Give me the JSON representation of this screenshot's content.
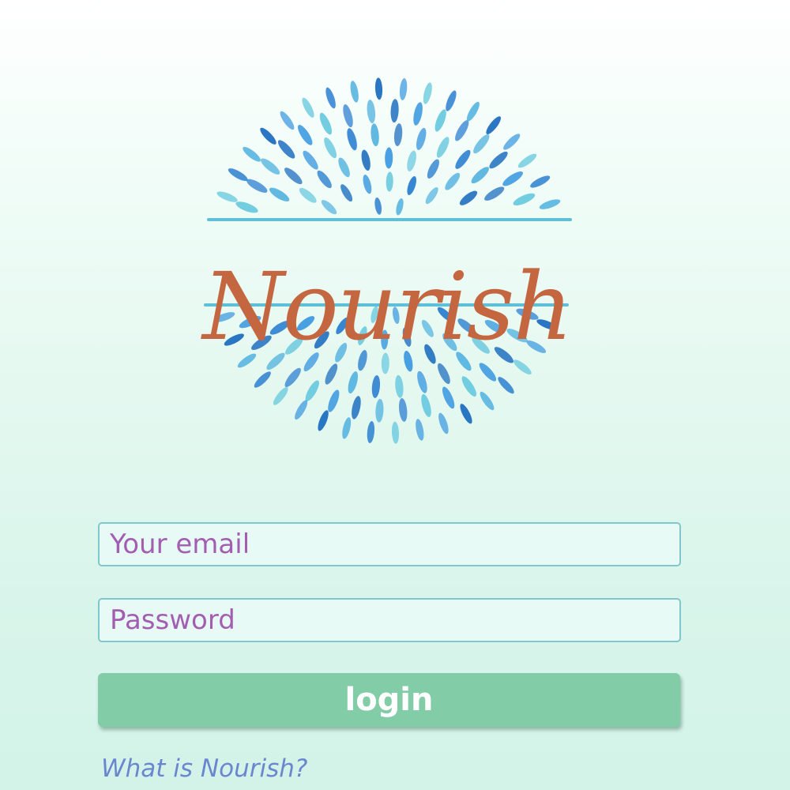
{
  "brand": {
    "name": "Nourish",
    "text_color": "#c4663f",
    "petal_colors": [
      "#2c7fd0",
      "#3f9be0",
      "#58b5e0",
      "#6ccadf",
      "#1f6fbf"
    ]
  },
  "login_form": {
    "email_placeholder": "Your email",
    "password_placeholder": "Password",
    "submit_label": "login",
    "about_link": "What is Nourish?"
  },
  "colors": {
    "input_border": "#7fc7cb",
    "placeholder_text": "#a35eb2",
    "button_background": "#82cda8",
    "link_text": "#6a86cf"
  }
}
